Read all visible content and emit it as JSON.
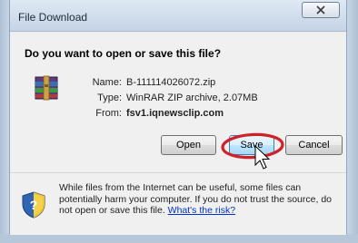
{
  "dialog": {
    "title": "File Download",
    "question": "Do you want to open or save this file?",
    "file": {
      "name_label": "Name:",
      "name_value": "B-111114026072.zip",
      "type_label": "Type:",
      "type_value": "WinRAR ZIP archive, 2.07MB",
      "from_label": "From:",
      "from_value": "fsv1.iqnewsclip.com",
      "icon": "winrar-archive-icon"
    },
    "buttons": {
      "open": "Open",
      "save": "Save",
      "cancel": "Cancel"
    },
    "warning": {
      "text": "While files from the Internet can be useful, some files can potentially harm your computer. If you do not trust the source, do not open or save this file.",
      "link": "What's the risk?",
      "icon": "security-shield-icon"
    },
    "close_icon": "close-icon"
  },
  "colors": {
    "highlight": "#d0202a",
    "link": "#0033cc"
  }
}
